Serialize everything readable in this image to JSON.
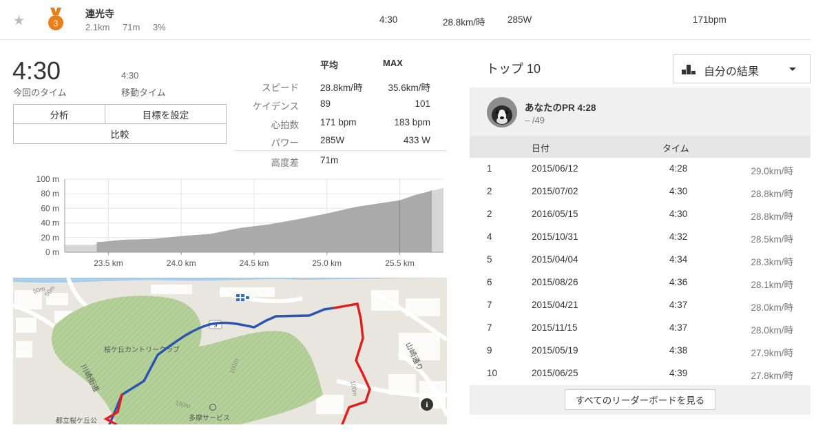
{
  "segment_row": {
    "name": "連光寺",
    "distance": "2.1km",
    "elevation": "71m",
    "grade": "3%",
    "medal_rank": "3",
    "time": "4:30",
    "speed": "28.8km/時",
    "power": "285W",
    "heart_rate": "171bpm"
  },
  "summary": {
    "elapsed_time": "4:30",
    "elapsed_label": "今回のタイム",
    "moving_time": "4:30",
    "moving_label": "移動タイム",
    "buttons": {
      "analysis": "分析",
      "set_goal": "目標を設定",
      "compare": "比較"
    }
  },
  "stats": {
    "avg_header": "平均",
    "max_header": "MAX",
    "rows": [
      {
        "label": "スピード",
        "avg": "28.8km/時",
        "max": "35.6km/時"
      },
      {
        "label": "ケイデンス",
        "avg": "89",
        "max": "101"
      },
      {
        "label": "心拍数",
        "avg": "171 bpm",
        "max": "183 bpm"
      },
      {
        "label": "パワー",
        "avg": "285W",
        "max": "433 W"
      }
    ],
    "elev_label": "高度差",
    "elev_value": "71m"
  },
  "chart_data": {
    "type": "area",
    "x": [
      23.2,
      23.4,
      23.45,
      23.6,
      23.8,
      24.0,
      24.2,
      24.4,
      24.6,
      24.8,
      25.0,
      25.2,
      25.4,
      25.5,
      25.6,
      25.7,
      25.8
    ],
    "y": [
      10,
      10,
      14,
      17,
      18,
      22,
      25,
      33,
      38,
      45,
      53,
      62,
      68,
      71,
      78,
      83,
      88
    ],
    "segment_start_km": 23.42,
    "segment_end_km": 25.72,
    "xlim": [
      23.2,
      25.8
    ],
    "ylim": [
      0,
      100
    ],
    "xticks": [
      "23.5 km",
      "24.0 km",
      "24.5 km",
      "25.0 km",
      "25.5 km"
    ],
    "yticks": [
      "0 m",
      "20 m",
      "40 m",
      "60 m",
      "80 m",
      "100 m"
    ],
    "grid": true
  },
  "map": {
    "labels": {
      "road1": "川崎街道",
      "road2": "山崎通り",
      "park": "桜ケ丘カントリークラブ",
      "service": "多摩サービス",
      "park2": "都立桜ケ丘公",
      "contour1": "50m",
      "contour2": "50m",
      "contour3": "100m",
      "contour4": "100m",
      "contour5": "150m",
      "route_num": "9"
    },
    "info_icon": "i"
  },
  "leaderboard": {
    "title": "トップ 10",
    "filter_label": "自分の結果",
    "pr_title": "あなたのPR 4:28",
    "pr_rank": "– /49",
    "headers": {
      "date": "日付",
      "time": "タイム"
    },
    "rows": [
      {
        "rank": "1",
        "date": "2015/06/12",
        "time": "4:28",
        "speed": "29.0km/時"
      },
      {
        "rank": "2",
        "date": "2015/07/02",
        "time": "4:30",
        "speed": "28.8km/時"
      },
      {
        "rank": "2",
        "date": "2016/05/15",
        "time": "4:30",
        "speed": "28.8km/時"
      },
      {
        "rank": "4",
        "date": "2015/10/31",
        "time": "4:32",
        "speed": "28.5km/時"
      },
      {
        "rank": "5",
        "date": "2015/04/04",
        "time": "4:34",
        "speed": "28.3km/時"
      },
      {
        "rank": "6",
        "date": "2015/08/26",
        "time": "4:36",
        "speed": "28.1km/時"
      },
      {
        "rank": "7",
        "date": "2015/04/21",
        "time": "4:37",
        "speed": "28.0km/時"
      },
      {
        "rank": "7",
        "date": "2015/11/15",
        "time": "4:37",
        "speed": "28.0km/時"
      },
      {
        "rank": "9",
        "date": "2015/05/19",
        "time": "4:38",
        "speed": "27.9km/時"
      },
      {
        "rank": "10",
        "date": "2015/06/25",
        "time": "4:39",
        "speed": "27.8km/時"
      }
    ],
    "see_all": "すべてのリーダーボードを見る"
  },
  "colors": {
    "medal": "#e8801a",
    "route_blue": "#2b55b0",
    "route_red": "#e41e1e",
    "map_green": "#b9d3a0"
  }
}
